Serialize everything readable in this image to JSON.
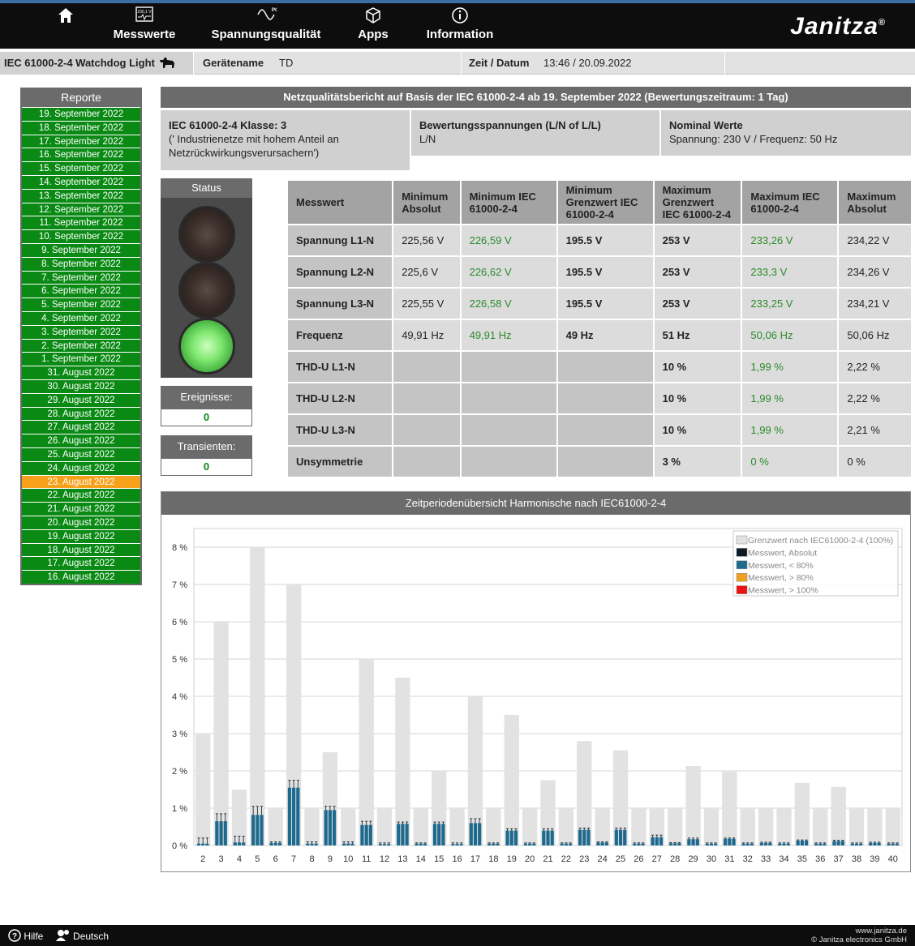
{
  "nav": {
    "home_icon": "home-icon",
    "items": [
      {
        "label": "Messwerte",
        "icon": "measurements-icon"
      },
      {
        "label": "Spannungsqualität",
        "icon": "pq-icon"
      },
      {
        "label": "Apps",
        "icon": "apps-icon"
      },
      {
        "label": "Information",
        "icon": "info-icon"
      }
    ],
    "logo": "Janitza",
    "logo_mark": "®",
    "meter_icon_text": "230,1 V",
    "pq_icon_text": "PQ"
  },
  "infobar": {
    "app_title": "IEC 61000-2-4 Watchdog Light",
    "device_label": "Gerätename",
    "device_value": "TD",
    "time_label": "Zeit / Datum",
    "time_value": "13:46 / 20.09.2022"
  },
  "sidebar": {
    "title": "Reporte",
    "selected": "23. August 2022",
    "items": [
      "19. September 2022",
      "18. September 2022",
      "17. September 2022",
      "16. September 2022",
      "15. September 2022",
      "14. September 2022",
      "13. September 2022",
      "12. September 2022",
      "11. September 2022",
      "10. September 2022",
      "9. September 2022",
      "8. September 2022",
      "7. September 2022",
      "6. September 2022",
      "5. September 2022",
      "4. September 2022",
      "3. September 2022",
      "2. September 2022",
      "1. September 2022",
      "31. August 2022",
      "30. August 2022",
      "29. August 2022",
      "28. August 2022",
      "27. August 2022",
      "26. August 2022",
      "25. August 2022",
      "24. August 2022",
      "23. August 2022",
      "22. August 2022",
      "21. August 2022",
      "20. August 2022",
      "19. August 2022",
      "18. August 2022",
      "17. August 2022",
      "16. August 2022"
    ]
  },
  "report": {
    "header": "Netzqualitätsbericht auf Basis der IEC 61000-2-4 ab 19. September 2022 (Bewertungszeitraum: 1 Tag)",
    "class_title": "IEC 61000-2-4 Klasse: 3",
    "class_desc": "(' Industrienetze mit hohem Anteil an Netzrückwirkungsverursachern')",
    "voltage_title": "Bewertungsspannungen (L/N of L/L)",
    "voltage_value": "L/N",
    "nominal_title": "Nominal Werte",
    "nominal_value": "Spannung: 230 V / Frequenz: 50 Hz"
  },
  "status": {
    "title": "Status",
    "events_label": "Ereignisse:",
    "events_value": "0",
    "transients_label": "Transienten:",
    "transients_value": "0"
  },
  "table": {
    "headers": [
      "Messwert",
      "Minimum Absolut",
      "Minimum IEC 61000-2-4",
      "Minimum Grenzwert IEC 61000-2-4",
      "Maximum Grenzwert IEC 61000-2-4",
      "Maximum IEC 61000-2-4",
      "Maximum Absolut"
    ],
    "rows": [
      [
        "Spannung L1-N",
        "225,56 V",
        "226,59 V",
        "195.5 V",
        "253 V",
        "233,26 V",
        "234,22 V"
      ],
      [
        "Spannung L2-N",
        "225,6 V",
        "226,62 V",
        "195.5 V",
        "253 V",
        "233,3 V",
        "234,26 V"
      ],
      [
        "Spannung L3-N",
        "225,55 V",
        "226,58 V",
        "195.5 V",
        "253 V",
        "233,25 V",
        "234,21 V"
      ],
      [
        "Frequenz",
        "49,91 Hz",
        "49,91 Hz",
        "49 Hz",
        "51 Hz",
        "50,06 Hz",
        "50,06 Hz"
      ],
      [
        "THD-U L1-N",
        "",
        "",
        "",
        "10 %",
        "1,99 %",
        "2,22 %"
      ],
      [
        "THD-U L2-N",
        "",
        "",
        "",
        "10 %",
        "1,99 %",
        "2,22 %"
      ],
      [
        "THD-U L3-N",
        "",
        "",
        "",
        "10 %",
        "1,99 %",
        "2,21 %"
      ],
      [
        "Unsymmetrie",
        "",
        "",
        "",
        "3 %",
        "0 %",
        "0 %"
      ]
    ]
  },
  "chart_title": "Zeitperiodenübersicht Harmonische nach IEC61000-2-4",
  "chart_data": {
    "type": "bar",
    "title": "Zeitperiodenübersicht Harmonische nach IEC61000-2-4",
    "categories": [
      "2",
      "3",
      "4",
      "5",
      "6",
      "7",
      "8",
      "9",
      "10",
      "11",
      "12",
      "13",
      "14",
      "15",
      "16",
      "17",
      "18",
      "19",
      "20",
      "21",
      "22",
      "23",
      "24",
      "25",
      "26",
      "27",
      "28",
      "29",
      "30",
      "31",
      "32",
      "33",
      "34",
      "35",
      "36",
      "37",
      "38",
      "39",
      "40"
    ],
    "ylim": [
      0,
      8.5
    ],
    "yticks": [
      "0 %",
      "1 %",
      "2 %",
      "3 %",
      "4 %",
      "5 %",
      "6 %",
      "7 %",
      "8 %"
    ],
    "grid": true,
    "legend_position": "top-right",
    "legend": [
      {
        "label": "Grenzwert nach IEC61000-2-4 (100%)",
        "color": "#e2e2e2"
      },
      {
        "label": "Messwert, Absolut",
        "color": "#0b1a24"
      },
      {
        "label": "Messwert, < 80%",
        "color": "#1e6a8e"
      },
      {
        "label": "Messwert, > 80%",
        "color": "#f0a020"
      },
      {
        "label": "Messwert, > 100%",
        "color": "#ee1111"
      }
    ],
    "series": [
      {
        "name": "Grenzwert nach IEC61000-2-4 (100%)",
        "values": [
          3,
          6,
          1.5,
          8,
          1,
          7,
          1,
          2.5,
          1,
          5,
          1,
          4.5,
          1,
          2,
          1,
          4,
          1,
          3.5,
          1,
          1.75,
          1,
          2.8,
          1,
          2.55,
          1,
          1,
          1,
          2.13,
          1,
          1.98,
          1,
          1,
          1,
          1.68,
          1,
          1.57,
          1,
          1,
          1
        ]
      },
      {
        "name": "Messwert, < 80%",
        "values": [
          0.05,
          0.65,
          0.08,
          0.82,
          0.07,
          1.55,
          0.05,
          0.95,
          0.05,
          0.55,
          0.04,
          0.58,
          0.05,
          0.58,
          0.04,
          0.6,
          0.05,
          0.4,
          0.05,
          0.4,
          0.05,
          0.42,
          0.08,
          0.42,
          0.05,
          0.22,
          0.06,
          0.17,
          0.05,
          0.18,
          0.05,
          0.07,
          0.05,
          0.13,
          0.05,
          0.12,
          0.05,
          0.07,
          0.05
        ]
      },
      {
        "name": "Messwert, Absolut",
        "values": [
          0.2,
          0.85,
          0.25,
          1.05,
          0.1,
          1.75,
          0.1,
          1.05,
          0.1,
          0.65,
          0.07,
          0.63,
          0.07,
          0.63,
          0.07,
          0.72,
          0.07,
          0.45,
          0.07,
          0.45,
          0.07,
          0.47,
          0.1,
          0.47,
          0.07,
          0.28,
          0.08,
          0.2,
          0.07,
          0.2,
          0.07,
          0.09,
          0.07,
          0.15,
          0.07,
          0.14,
          0.07,
          0.09,
          0.07
        ]
      }
    ]
  },
  "footer": {
    "help": "Hilfe",
    "language": "Deutsch",
    "website": "www.janitza.de",
    "copyright": "© Janitza electronics GmbH"
  }
}
